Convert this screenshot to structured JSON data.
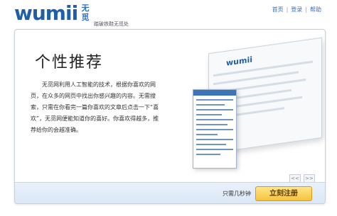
{
  "header": {
    "logo_word": "wumii",
    "logo_cn": "无觅",
    "tagline": "踏破铁鞋无觅处"
  },
  "topnav": {
    "items": [
      "首页",
      "登录",
      "帮助"
    ]
  },
  "main": {
    "title": "个性推荐",
    "description": "无觅网利用人工智能的技术，根据你喜欢的网页，在众多的网页中找出你感兴趣的内容。无需搜索，只需在你看完一篇你喜欢的文章后点击一下“喜欢”，无觅网便能知道你的喜好。你喜欢得越多，推荐给你的会越准确。",
    "preview_logo": "wumii"
  },
  "pager": {
    "prev": "<<",
    "next": ">>"
  },
  "footer": {
    "text": "只需几秒钟",
    "register_label": "立刻注册"
  }
}
